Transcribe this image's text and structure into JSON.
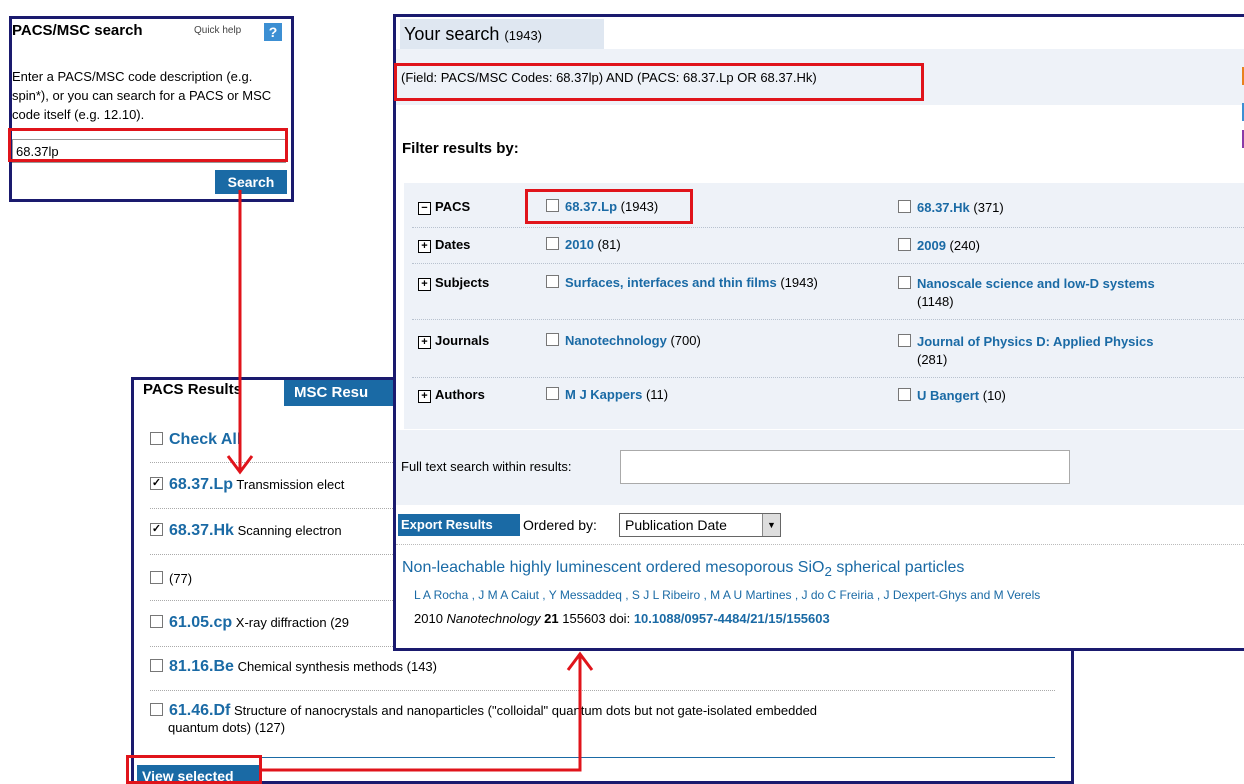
{
  "pacs_search": {
    "title": "PACS/MSC search",
    "quick_help": "Quick help",
    "help_icon": "?",
    "description": "Enter a PACS/MSC code description (e.g. spin*), or you can search for a PACS or MSC code itself (e.g. 12.10).",
    "input_value": "68.37lp",
    "search_button": "Search"
  },
  "pacs_results": {
    "tab_pacs": "PACS Results",
    "tab_msc": "MSC Resu",
    "check_all": "Check All",
    "items": [
      {
        "code": "68.37.Lp",
        "desc": "Transmission elect",
        "checked": true
      },
      {
        "code": "68.37.Hk",
        "desc": "Scanning electron",
        "checked": true
      },
      {
        "code": "",
        "desc": "(77)",
        "checked": false
      },
      {
        "code": "61.05.cp",
        "desc": "X-ray diffraction (29",
        "checked": false
      },
      {
        "code": "81.16.Be",
        "desc": "Chemical synthesis methods (143)",
        "checked": false
      },
      {
        "code": "61.46.Df",
        "desc": "Structure of nanocrystals and nanoparticles (\"colloidal\" quantum dots but not gate-isolated embedded",
        "desc2": "quantum dots) (127)",
        "checked": false
      }
    ],
    "view_selected": "View selected"
  },
  "your_search": {
    "title": "Your search",
    "count": "(1943)",
    "query": "(Field: PACS/MSC Codes: 68.37lp) AND (PACS: 68.37.Lp OR 68.37.Hk)",
    "filter_heading": "Filter results by:",
    "filters": [
      {
        "label": "PACS",
        "expanded": true,
        "a": {
          "name": "68.37.Lp",
          "count": "(1943)"
        },
        "b": {
          "name": "68.37.Hk",
          "count": "(371)"
        }
      },
      {
        "label": "Dates",
        "expanded": false,
        "a": {
          "name": "2010",
          "count": "(81)"
        },
        "b": {
          "name": "2009",
          "count": "(240)"
        }
      },
      {
        "label": "Subjects",
        "expanded": false,
        "a": {
          "name": "Surfaces, interfaces and thin films",
          "count": "(1943)"
        },
        "b": {
          "name": "Nanoscale science and low-D systems",
          "count": "(1148)"
        }
      },
      {
        "label": "Journals",
        "expanded": false,
        "a": {
          "name": "Nanotechnology",
          "count": "(700)"
        },
        "b": {
          "name": "Journal of Physics D: Applied Physics",
          "count": "(281)"
        }
      },
      {
        "label": "Authors",
        "expanded": false,
        "a": {
          "name": "M J Kappers",
          "count": "(11)"
        },
        "b": {
          "name": "U Bangert",
          "count": "(10)"
        }
      }
    ],
    "fulltext_label": "Full text search within results:",
    "export_button": "Export Results",
    "ordered_by": "Ordered by:",
    "order_value": "Publication Date",
    "result": {
      "title_pre": "Non-leachable highly luminescent ordered mesoporous SiO",
      "title_sub": "2",
      "title_post": " spherical particles",
      "authors": "L A Rocha , J M A Caiut , Y Messaddeq , S J L Ribeiro , M A U Martines , J do C Freiria , J Dexpert-Ghys and  M Verels",
      "year": "2010",
      "journal": "Nanotechnology",
      "volume": "21",
      "article": "155603 doi:",
      "doi": "10.1088/0957-4484/21/15/155603"
    }
  },
  "colors": {
    "highlight": "#e0141b",
    "frame": "#1a1a6e",
    "link": "#1a6aa5"
  }
}
